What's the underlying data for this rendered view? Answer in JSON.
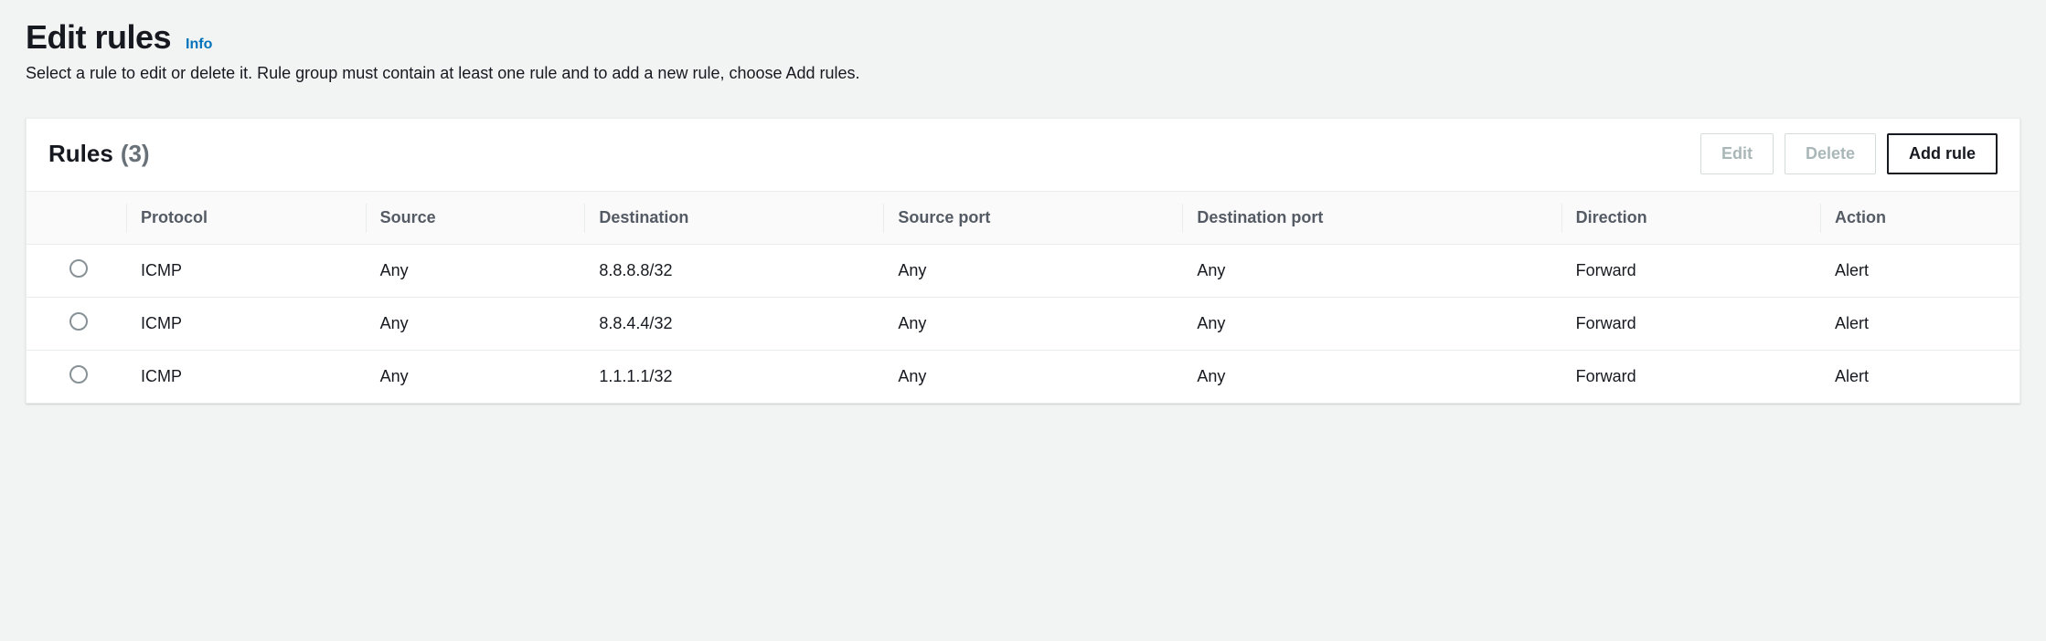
{
  "header": {
    "title": "Edit rules",
    "info_label": "Info",
    "subtitle": "Select a rule to edit or delete it. Rule group must contain at least one rule and to add a new rule, choose Add rules."
  },
  "panel": {
    "title": "Rules",
    "count_display": "(3)",
    "buttons": {
      "edit": "Edit",
      "delete": "Delete",
      "add": "Add rule"
    }
  },
  "columns": {
    "protocol": "Protocol",
    "source": "Source",
    "destination": "Destination",
    "source_port": "Source port",
    "destination_port": "Destination port",
    "direction": "Direction",
    "action": "Action"
  },
  "rows": [
    {
      "protocol": "ICMP",
      "source": "Any",
      "destination": "8.8.8.8/32",
      "source_port": "Any",
      "destination_port": "Any",
      "direction": "Forward",
      "action": "Alert"
    },
    {
      "protocol": "ICMP",
      "source": "Any",
      "destination": "8.8.4.4/32",
      "source_port": "Any",
      "destination_port": "Any",
      "direction": "Forward",
      "action": "Alert"
    },
    {
      "protocol": "ICMP",
      "source": "Any",
      "destination": "1.1.1.1/32",
      "source_port": "Any",
      "destination_port": "Any",
      "direction": "Forward",
      "action": "Alert"
    }
  ]
}
